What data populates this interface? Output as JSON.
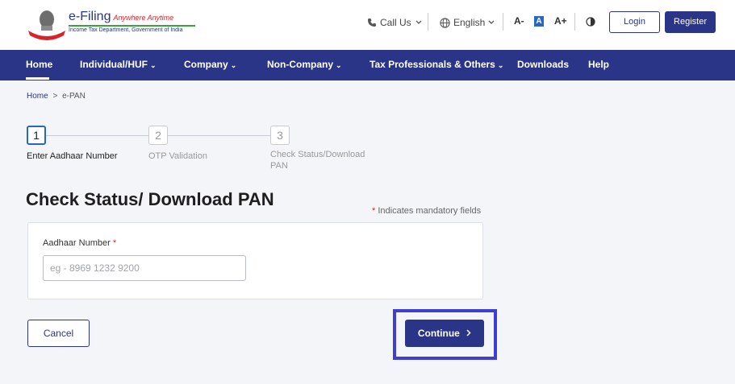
{
  "header": {
    "logo": {
      "title": "e-Filing",
      "tagline": "Anywhere Anytime",
      "subtitle": "Income Tax Department, Government of India"
    },
    "call_us": "Call Us",
    "language": "English",
    "font_decrease": "A-",
    "font_default": "A",
    "font_increase": "A+",
    "login_label": "Login",
    "register_label": "Register"
  },
  "nav": {
    "items": [
      {
        "label": "Home",
        "dropdown": false,
        "active": true
      },
      {
        "label": "Individual/HUF",
        "dropdown": true
      },
      {
        "label": "Company",
        "dropdown": true
      },
      {
        "label": "Non-Company",
        "dropdown": true
      },
      {
        "label": "Tax Professionals & Others",
        "dropdown": true
      },
      {
        "label": "Downloads",
        "dropdown": false
      },
      {
        "label": "Help",
        "dropdown": false
      }
    ]
  },
  "breadcrumb": {
    "home": "Home",
    "separator": ">",
    "current": "e-PAN"
  },
  "stepper": {
    "steps": [
      {
        "number": "1",
        "label": "Enter Aadhaar Number",
        "active": true
      },
      {
        "number": "2",
        "label": "OTP Validation",
        "active": false
      },
      {
        "number": "3",
        "label": "Check Status/Download PAN",
        "active": false
      }
    ]
  },
  "page": {
    "title": "Check Status/ Download PAN",
    "mandatory_note": "Indicates mandatory fields",
    "required_marker": "*"
  },
  "form": {
    "aadhaar_label": "Aadhaar Number",
    "aadhaar_value": "",
    "aadhaar_placeholder": "eg - 8969 1232 9200"
  },
  "actions": {
    "cancel_label": "Cancel",
    "continue_label": "Continue",
    "continue_chevron": ">"
  },
  "colors": {
    "brand_navy": "#2a3587",
    "active_blue": "#2867c5",
    "highlight": "#3e3fd1",
    "required_red": "#d8232a"
  }
}
